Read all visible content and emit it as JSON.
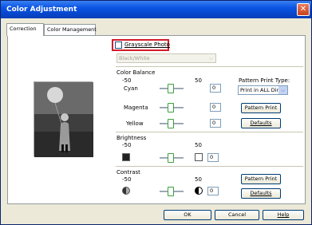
{
  "window": {
    "title": "Color Adjustment"
  },
  "tabs": [
    "Correction",
    "Color Management"
  ],
  "grayscale": {
    "label": "Grayscale Photo",
    "checked": false
  },
  "bw_select": {
    "value": "Black/White"
  },
  "color_balance": {
    "title": "Color Balance",
    "min": "-50",
    "max": "50",
    "rows": [
      {
        "label": "Cyan",
        "value": "0"
      },
      {
        "label": "Magenta",
        "value": "0"
      },
      {
        "label": "Yellow",
        "value": "0"
      }
    ]
  },
  "pattern_print_type": {
    "label": "Pattern Print Type:",
    "value": "Print in ALL Directio..."
  },
  "buttons": {
    "pattern_print": "Pattern Print",
    "defaults": "Defaults",
    "ok": "OK",
    "cancel": "Cancel",
    "help": "Help"
  },
  "brightness": {
    "title": "Brightness",
    "min": "-50",
    "max": "50",
    "value": "0"
  },
  "contrast": {
    "title": "Contrast",
    "min": "-50",
    "max": "50",
    "value": "0"
  },
  "colors": {
    "title_bar": "#0a54e3",
    "highlight": "#d31c2b",
    "slider_thumb": "#3d9e3d"
  }
}
